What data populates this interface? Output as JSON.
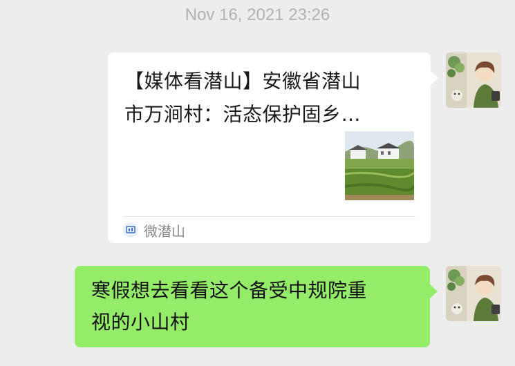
{
  "timestamp": "Nov 16, 2021 23:26",
  "messages": [
    {
      "type": "link-card",
      "sender": "self",
      "title": "【媒体看潜山】安徽省潜山\n市万涧村：活态保护固乡…",
      "source_name": "微潜山",
      "thumbnail_icon": "village-landscape-thumbnail"
    },
    {
      "type": "text",
      "sender": "self",
      "text": "寒假想去看看这个备受中规院重\n视的小山村"
    }
  ],
  "colors": {
    "background": "#ededed",
    "bubble_self": "#95ec69",
    "card": "#ffffff",
    "timestamp": "#b2b2b2",
    "source_text": "#888888"
  }
}
